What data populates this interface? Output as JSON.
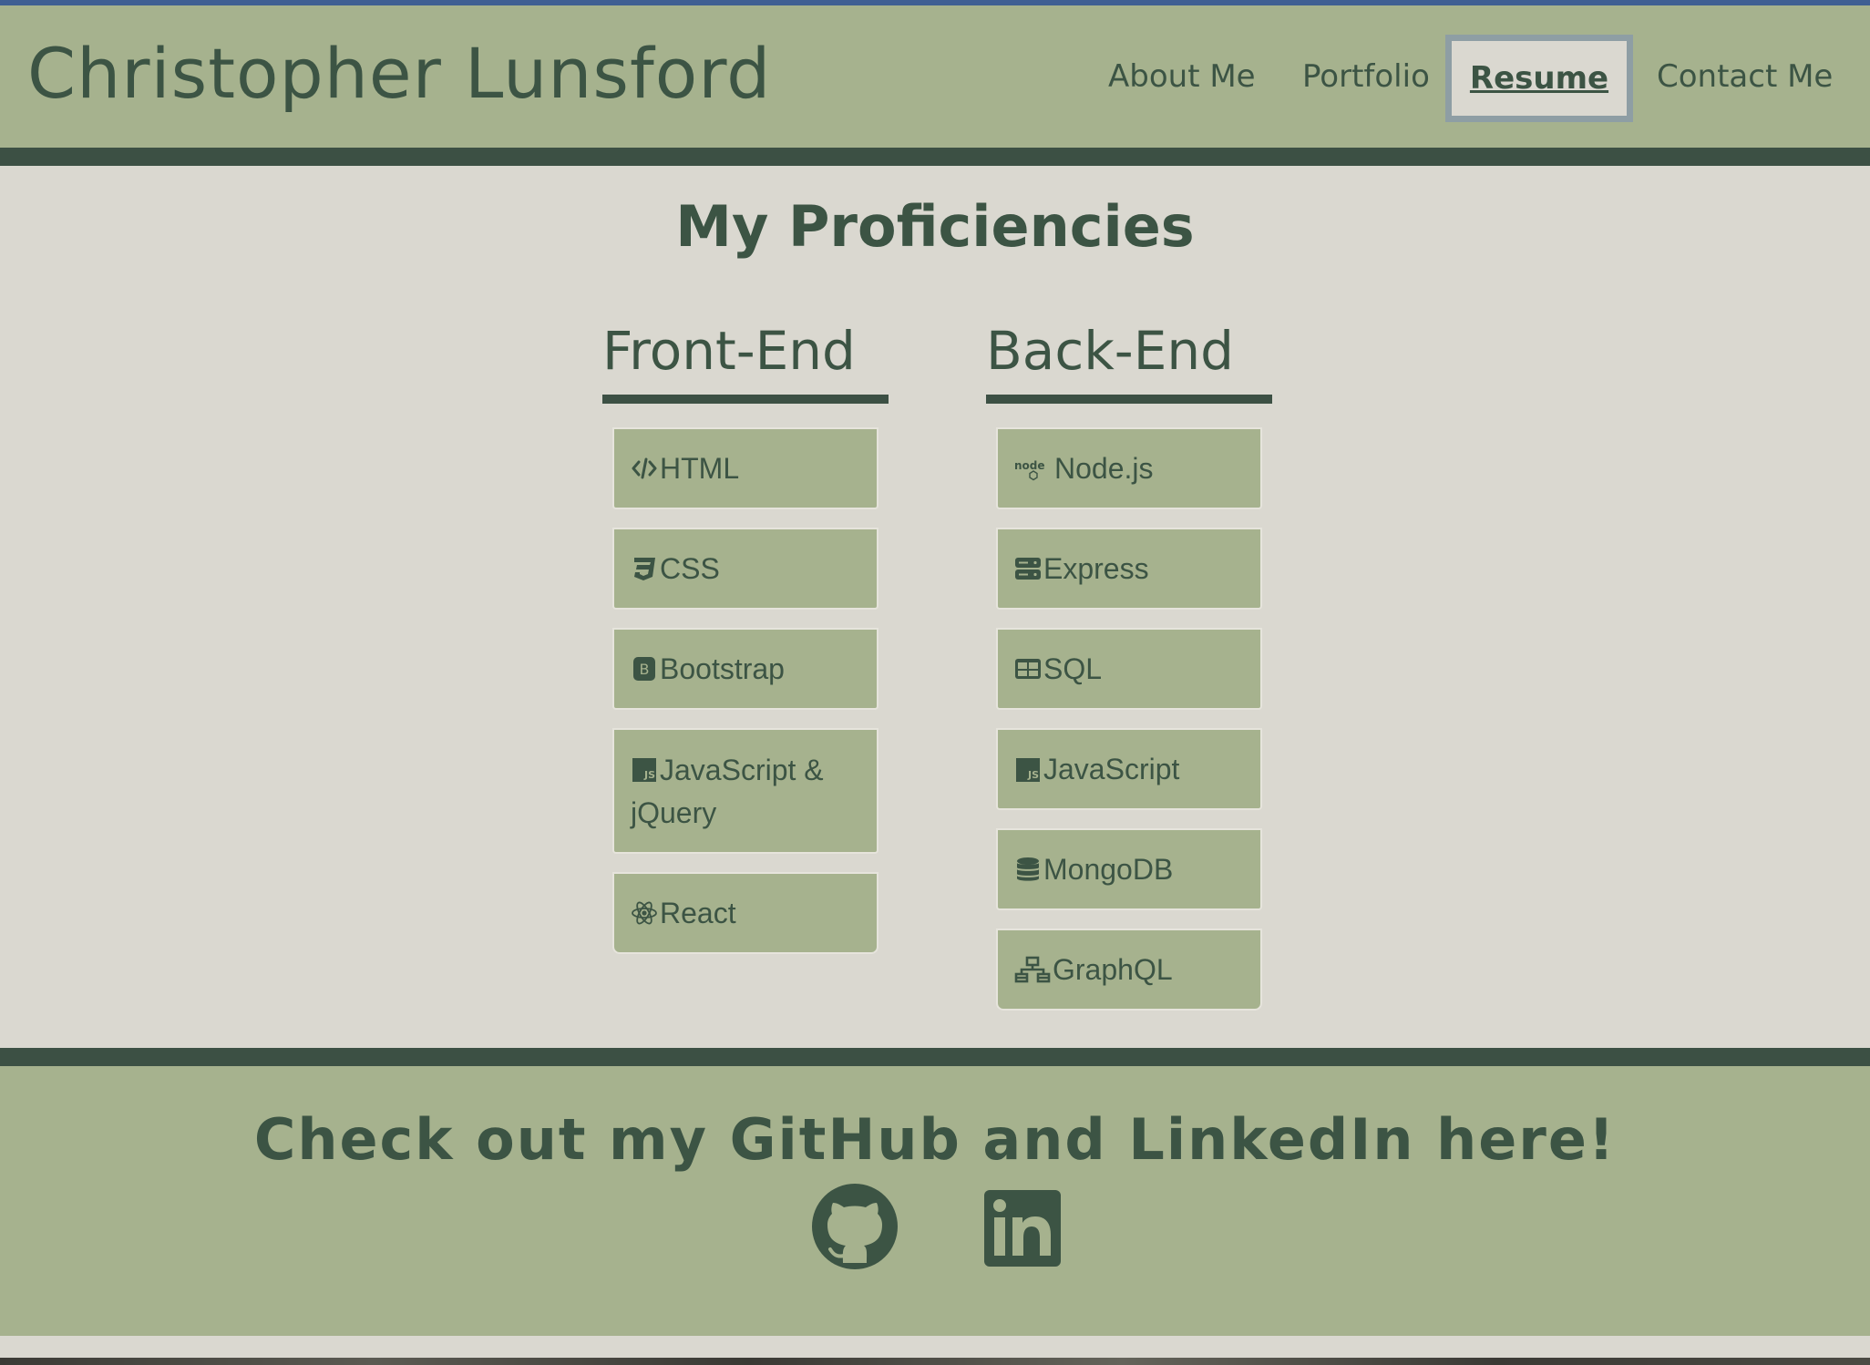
{
  "header": {
    "title": "Christopher Lunsford",
    "nav": [
      {
        "label": "About Me"
      },
      {
        "label": "Portfolio"
      },
      {
        "label": "Resume",
        "active": true
      },
      {
        "label": "Contact Me"
      }
    ]
  },
  "main": {
    "heading": "My Proficiencies",
    "front_end": {
      "title": "Front-End",
      "items": [
        {
          "label": "HTML",
          "icon": "code-icon"
        },
        {
          "label": "CSS",
          "icon": "css3-icon"
        },
        {
          "label": "Bootstrap",
          "icon": "bootstrap-icon"
        },
        {
          "label": "JavaScript & jQuery",
          "icon": "js-icon"
        },
        {
          "label": "React",
          "icon": "react-icon"
        }
      ]
    },
    "back_end": {
      "title": "Back-End",
      "items": [
        {
          "label": "Node.js",
          "icon": "node-icon"
        },
        {
          "label": "Express",
          "icon": "server-icon"
        },
        {
          "label": "SQL",
          "icon": "table-icon"
        },
        {
          "label": "JavaScript",
          "icon": "js-icon"
        },
        {
          "label": "MongoDB",
          "icon": "database-icon"
        },
        {
          "label": "GraphQL",
          "icon": "network-icon"
        }
      ]
    }
  },
  "footer": {
    "heading": "Check out my GitHub and LinkedIn here!",
    "links": [
      {
        "icon": "github-icon"
      },
      {
        "icon": "linkedin-icon"
      }
    ]
  },
  "colors": {
    "primary": "#3c5444",
    "header_bg": "#a6b28e",
    "page_bg": "#dad8d0",
    "band": "#3c5044",
    "active_border": "#8e9ea4",
    "top_line": "#3f5f93"
  }
}
